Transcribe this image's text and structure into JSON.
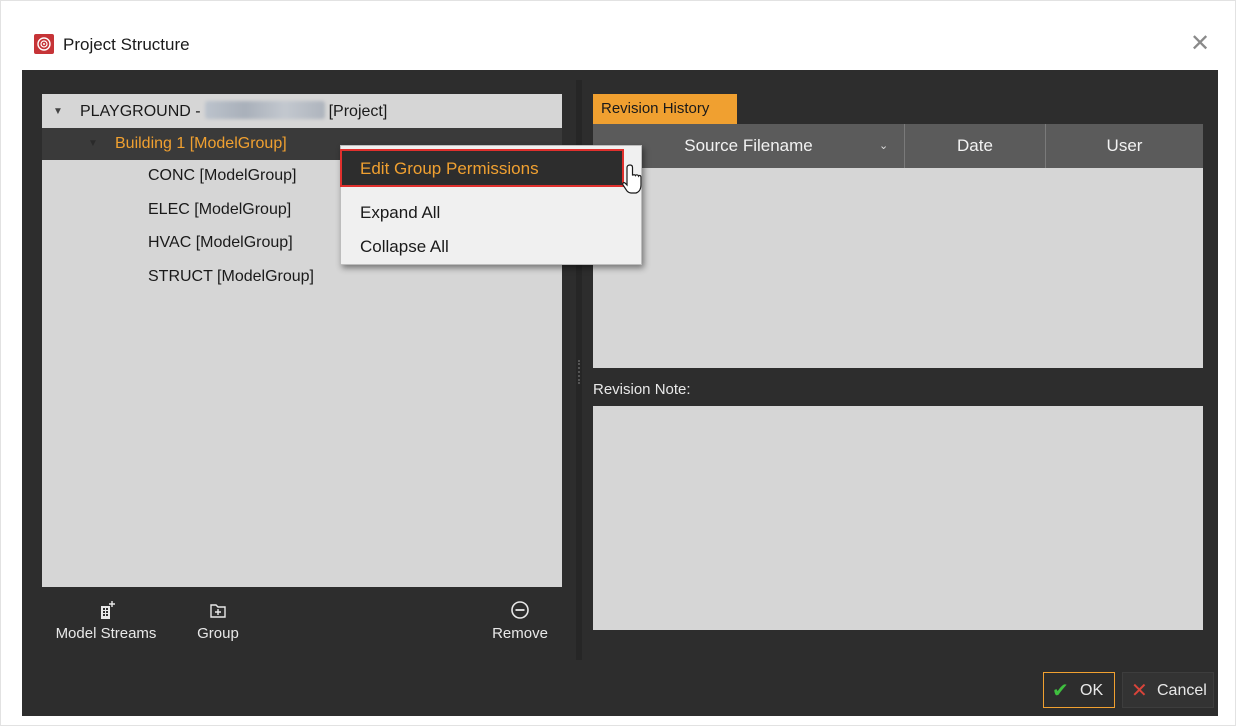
{
  "window": {
    "title": "Project Structure",
    "close_glyph": "✕",
    "accent_color": "#f0a030",
    "icon": "app-logo-icon"
  },
  "tree": {
    "root": {
      "prefix": "PLAYGROUND -",
      "suffix": "[Project]",
      "expander": "▼"
    },
    "selected": {
      "label": "Building 1 [ModelGroup]",
      "expander": "▼"
    },
    "children": [
      {
        "label": "CONC [ModelGroup]"
      },
      {
        "label": "ELEC [ModelGroup]"
      },
      {
        "label": "HVAC [ModelGroup]"
      },
      {
        "label": "STRUCT [ModelGroup]"
      }
    ]
  },
  "toolbar": {
    "model_streams": "Model Streams",
    "group": "Group",
    "remove": "Remove"
  },
  "context_menu": {
    "items": [
      {
        "label": "Edit Group Permissions"
      },
      {
        "label": "Expand All"
      },
      {
        "label": "Collapse All"
      }
    ]
  },
  "revision": {
    "tab": "Revision History",
    "columns": [
      "Source Filename",
      "Date",
      "User"
    ],
    "sort_glyph": "⌄",
    "note_label": "Revision Note:"
  },
  "buttons": {
    "ok": "OK",
    "ok_glyph": "✔",
    "cancel": "Cancel",
    "cancel_glyph": "✕"
  }
}
